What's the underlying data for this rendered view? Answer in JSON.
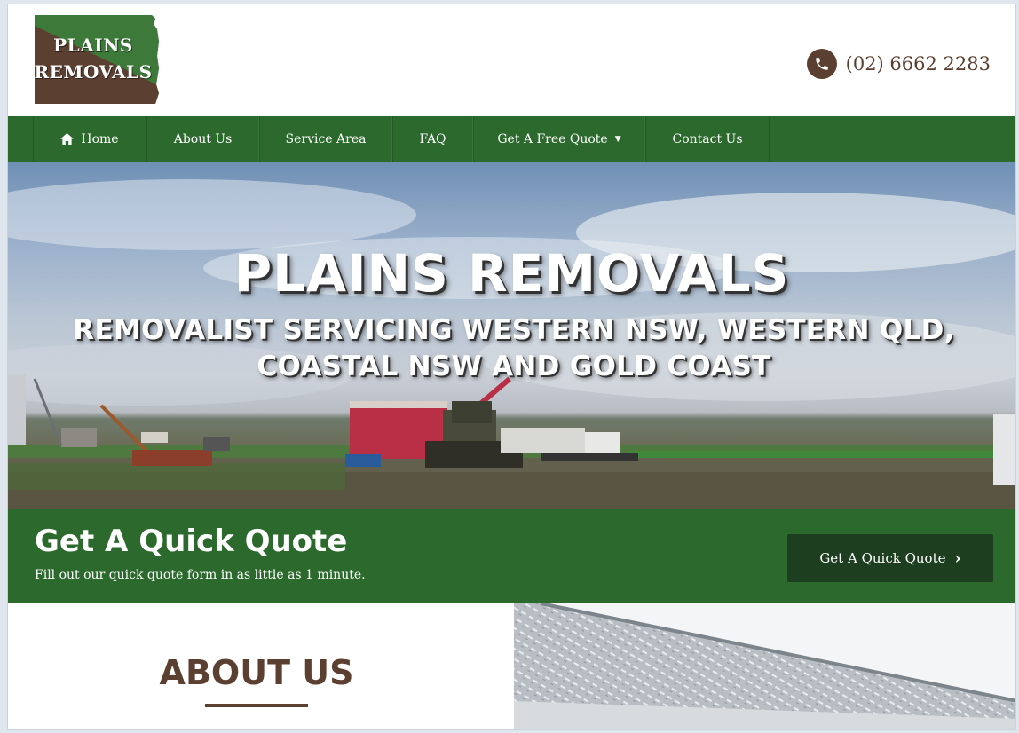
{
  "brand": {
    "logo_line1": "PLAINS",
    "logo_line2": "REMOVALS",
    "colors": {
      "green": "#2b6a2c",
      "brown": "#5b3f30",
      "dark_green": "#1d3f1f"
    }
  },
  "header": {
    "phone": "(02) 6662 2283",
    "phone_icon": "phone-icon"
  },
  "nav": {
    "items": [
      {
        "label": "Home",
        "icon": "home-icon"
      },
      {
        "label": "About Us"
      },
      {
        "label": "Service Area"
      },
      {
        "label": "FAQ"
      },
      {
        "label": "Get A Free Quote",
        "has_dropdown": true
      },
      {
        "label": "Contact Us"
      }
    ]
  },
  "hero": {
    "title": "PLAINS REMOVALS",
    "subtitle_line1": "REMOVALIST SERVICING WESTERN NSW, WESTERN QLD,",
    "subtitle_line2": "COASTAL NSW AND GOLD COAST"
  },
  "quote": {
    "title": "Get A Quick Quote",
    "subtitle": "Fill out our quick quote form in as little as 1 minute.",
    "button_label": "Get A Quick Quote",
    "button_icon": "chevron-right-icon"
  },
  "about": {
    "title": "ABOUT US"
  }
}
